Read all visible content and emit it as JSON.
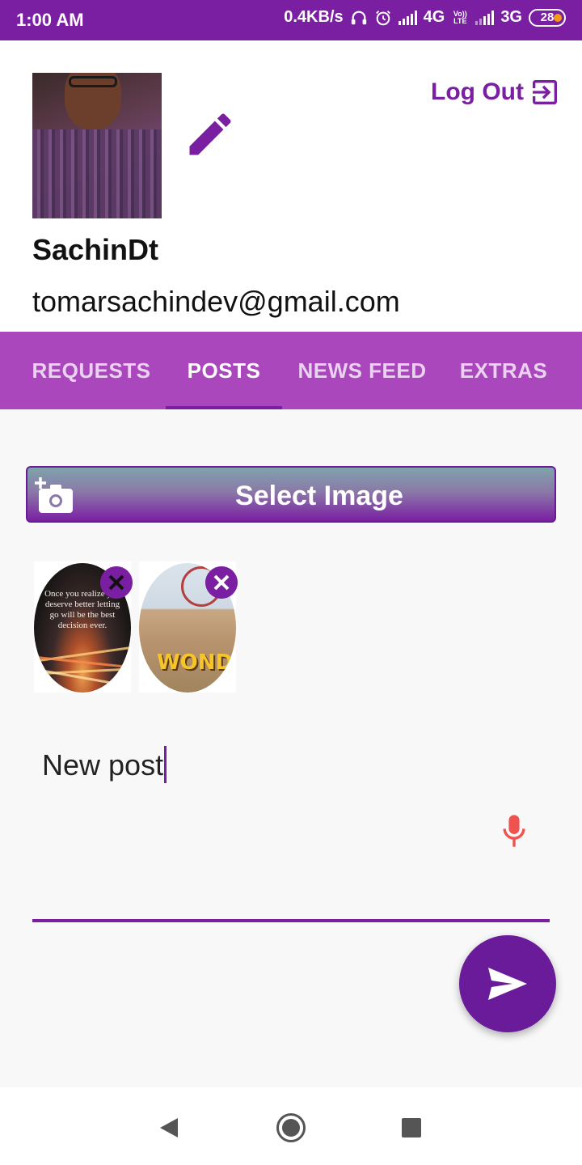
{
  "status_bar": {
    "time": "1:00 AM",
    "net_speed": "0.4KB/s",
    "network1": "4G",
    "volte": "Vo)) LTE",
    "network2": "3G",
    "battery": "28"
  },
  "profile": {
    "username": "SachinDt",
    "email": "tomarsachindev@gmail.com",
    "logout_label": "Log Out"
  },
  "tabs": [
    {
      "label": "REQUESTS",
      "active": false
    },
    {
      "label": "POSTS",
      "active": true
    },
    {
      "label": "NEWS FEED",
      "active": false
    },
    {
      "label": "EXTRAS",
      "active": false
    }
  ],
  "composer": {
    "select_image_label": "Select Image",
    "post_text": "New post",
    "images": [
      {
        "quote": "Once you realize you deserve better letting go will be the best decision ever."
      },
      {
        "logo_text": "WONDE"
      }
    ]
  },
  "colors": {
    "primary": "#7b1fa2",
    "tab_bar": "#ab47bc",
    "mic": "#ef5350"
  },
  "icons": [
    "edit-icon",
    "logout-icon",
    "add-photo-icon",
    "close-icon",
    "mic-icon",
    "send-icon",
    "back-icon",
    "home-icon",
    "recents-icon"
  ]
}
